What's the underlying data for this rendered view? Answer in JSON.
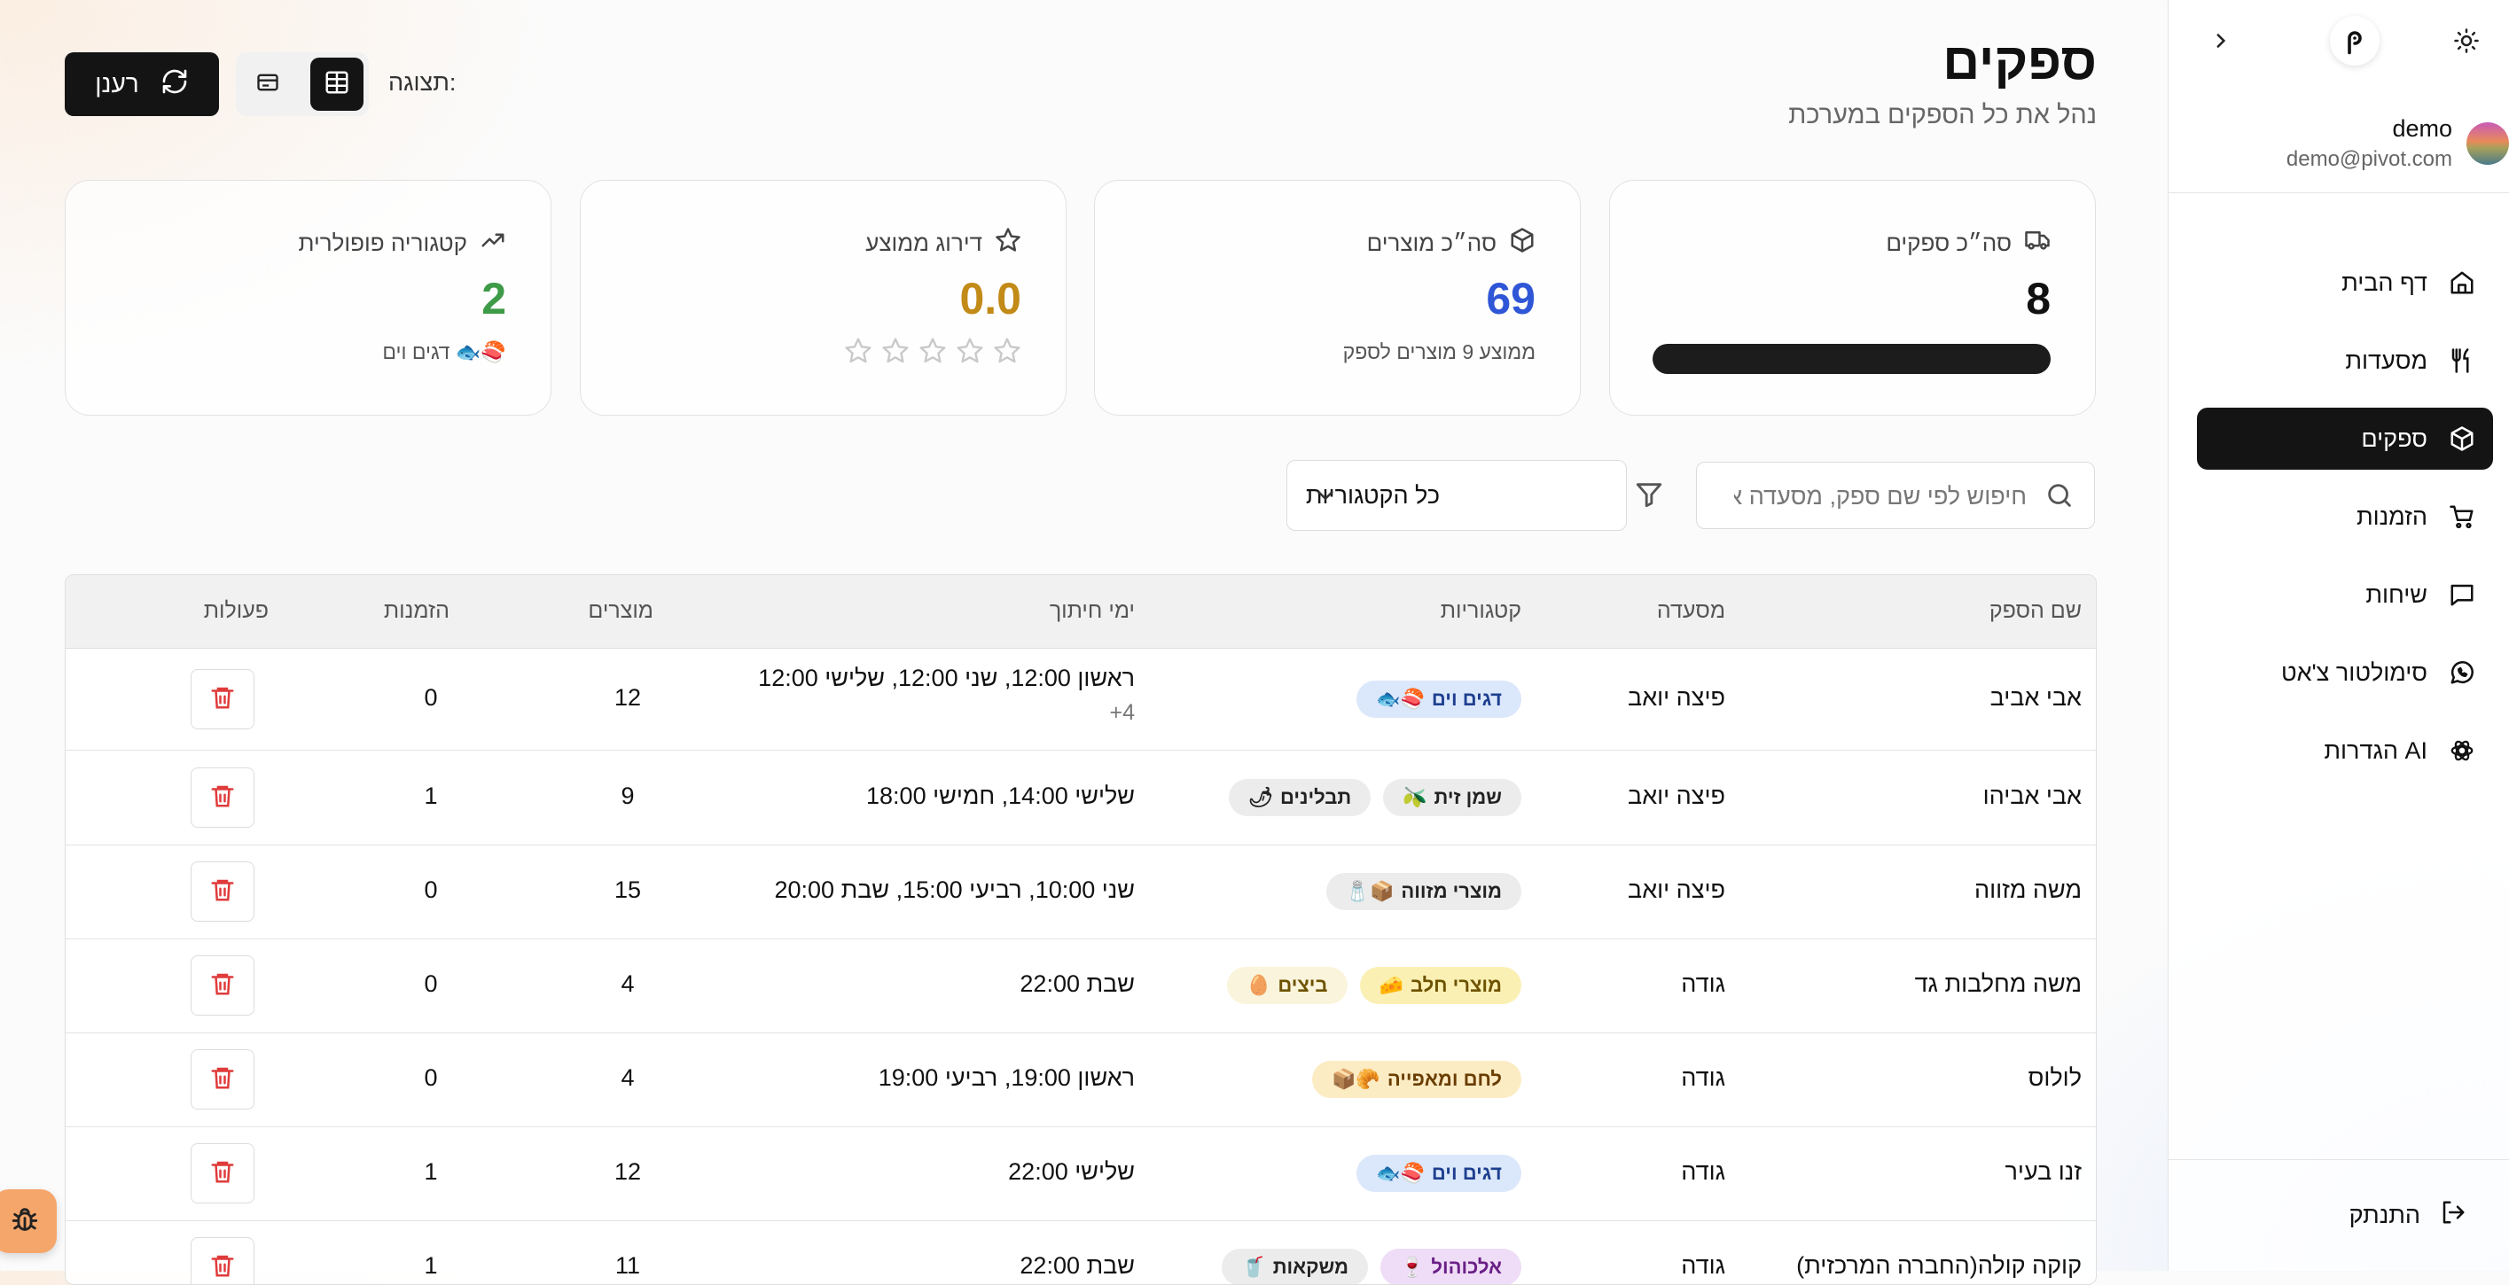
{
  "sidebar": {
    "user": {
      "name": "demo",
      "email": "demo@pivot.com"
    },
    "items": [
      {
        "label": "דף הבית",
        "icon": "home-icon"
      },
      {
        "label": "מסעדות",
        "icon": "utensils-icon"
      },
      {
        "label": "ספקים",
        "icon": "package-icon",
        "active": true
      },
      {
        "label": "הזמנות",
        "icon": "cart-icon"
      },
      {
        "label": "שיחות",
        "icon": "chat-icon"
      },
      {
        "label": "סימולטור צ'אט",
        "icon": "whatsapp-icon"
      },
      {
        "label": "הגדרות AI",
        "icon": "openai-icon"
      }
    ],
    "logout": "התנתק"
  },
  "header": {
    "title": "ספקים",
    "subtitle": "נהל את כל הספקים במערכת",
    "refresh": "רענן",
    "view_label": "תצוגה:"
  },
  "stats": {
    "suppliers": {
      "label": "סה״כ ספקים",
      "value": "8",
      "progress": 1.0
    },
    "products": {
      "label": "סה״כ מוצרים",
      "value": "69",
      "sub": "ממוצע 9 מוצרים לספק"
    },
    "rating": {
      "label": "דירוג ממוצע",
      "value": "0.0",
      "stars": 0
    },
    "popular": {
      "label": "קטגוריה פופולרית",
      "value": "2",
      "sub": "דגים וים"
    }
  },
  "filters": {
    "search_placeholder": "חיפוש לפי שם ספק, מסעדה או",
    "category_selected": "כל הקטגוריות"
  },
  "table": {
    "headers": {
      "name": "שם הספק",
      "restaurant": "מסעדה",
      "categories": "קטגוריות",
      "days": "ימי חיתוך",
      "products": "מוצרים",
      "orders": "הזמנות",
      "actions": "פעולות"
    },
    "rows": [
      {
        "name": "אבי אביב",
        "restaurant": "פיצה יואב",
        "badges": [
          {
            "label": "דגים וים",
            "emoji": "🐟🍣",
            "color": "blue"
          }
        ],
        "days": "ראשון 12:00, שני 12:00, שלישי 12:00",
        "more": "+4",
        "products": "12",
        "orders": "0"
      },
      {
        "name": "אבי אביהו",
        "restaurant": "פיצה יואב",
        "badges": [
          {
            "label": "שמן זית",
            "emoji": "🫒",
            "color": "gray"
          },
          {
            "label": "תבלינים",
            "emoji": "🌶",
            "color": "gray"
          }
        ],
        "days": "שלישי 14:00, חמישי 18:00",
        "products": "9",
        "orders": "1"
      },
      {
        "name": "משה מזווה",
        "restaurant": "פיצה יואב",
        "badges": [
          {
            "label": "מוצרי מזווה",
            "emoji": "🧂📦",
            "color": "gray"
          }
        ],
        "days": "שני 10:00, רביעי 15:00, שבת 20:00",
        "products": "15",
        "orders": "0"
      },
      {
        "name": "משה מחלבות גד",
        "restaurant": "גודה",
        "badges": [
          {
            "label": "מוצרי חלב",
            "emoji": "🧀",
            "color": "yellow"
          },
          {
            "label": "ביצים",
            "emoji": "🥚",
            "color": "cream"
          }
        ],
        "days": "שבת 22:00",
        "products": "4",
        "orders": "0"
      },
      {
        "name": "לולוס",
        "restaurant": "גודה",
        "badges": [
          {
            "label": "לחם ומאפייה",
            "emoji": "📦🥐",
            "color": "amber"
          }
        ],
        "days": "ראשון 19:00, רביעי 19:00",
        "products": "4",
        "orders": "0"
      },
      {
        "name": "זנו בעיר",
        "restaurant": "גודה",
        "badges": [
          {
            "label": "דגים וים",
            "emoji": "🐟🍣",
            "color": "blue"
          }
        ],
        "days": "שלישי 22:00",
        "products": "12",
        "orders": "1"
      },
      {
        "name": "קוקה קולה(החברה המרכזית)",
        "restaurant": "גודה",
        "badges": [
          {
            "label": "אלכוהול",
            "emoji": "🍷",
            "color": "purple"
          },
          {
            "label": "משקאות",
            "emoji": "🥤",
            "color": "gray"
          }
        ],
        "days": "שבת 22:00",
        "products": "11",
        "orders": "1"
      }
    ]
  },
  "colors": {
    "accent_dark": "#141414",
    "blue_value": "#2f56d6",
    "gold_value": "#c28a17",
    "green_value": "#3e9b47",
    "delete_red": "#e03b3b"
  }
}
